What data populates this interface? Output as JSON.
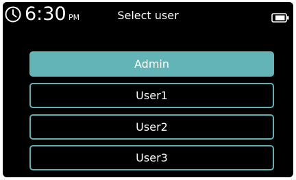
{
  "status": {
    "time": "6:30",
    "ampm": "PM",
    "clock_icon": "clock-icon",
    "battery_icon": "battery-icon"
  },
  "header": {
    "title": "Select user"
  },
  "users": {
    "items": [
      {
        "label": "Admin",
        "selected": true
      },
      {
        "label": "User1",
        "selected": false
      },
      {
        "label": "User2",
        "selected": false
      },
      {
        "label": "User3",
        "selected": false
      }
    ]
  },
  "colors": {
    "accent": "#62b4b6",
    "background": "#000000",
    "text": "#ffffff"
  }
}
